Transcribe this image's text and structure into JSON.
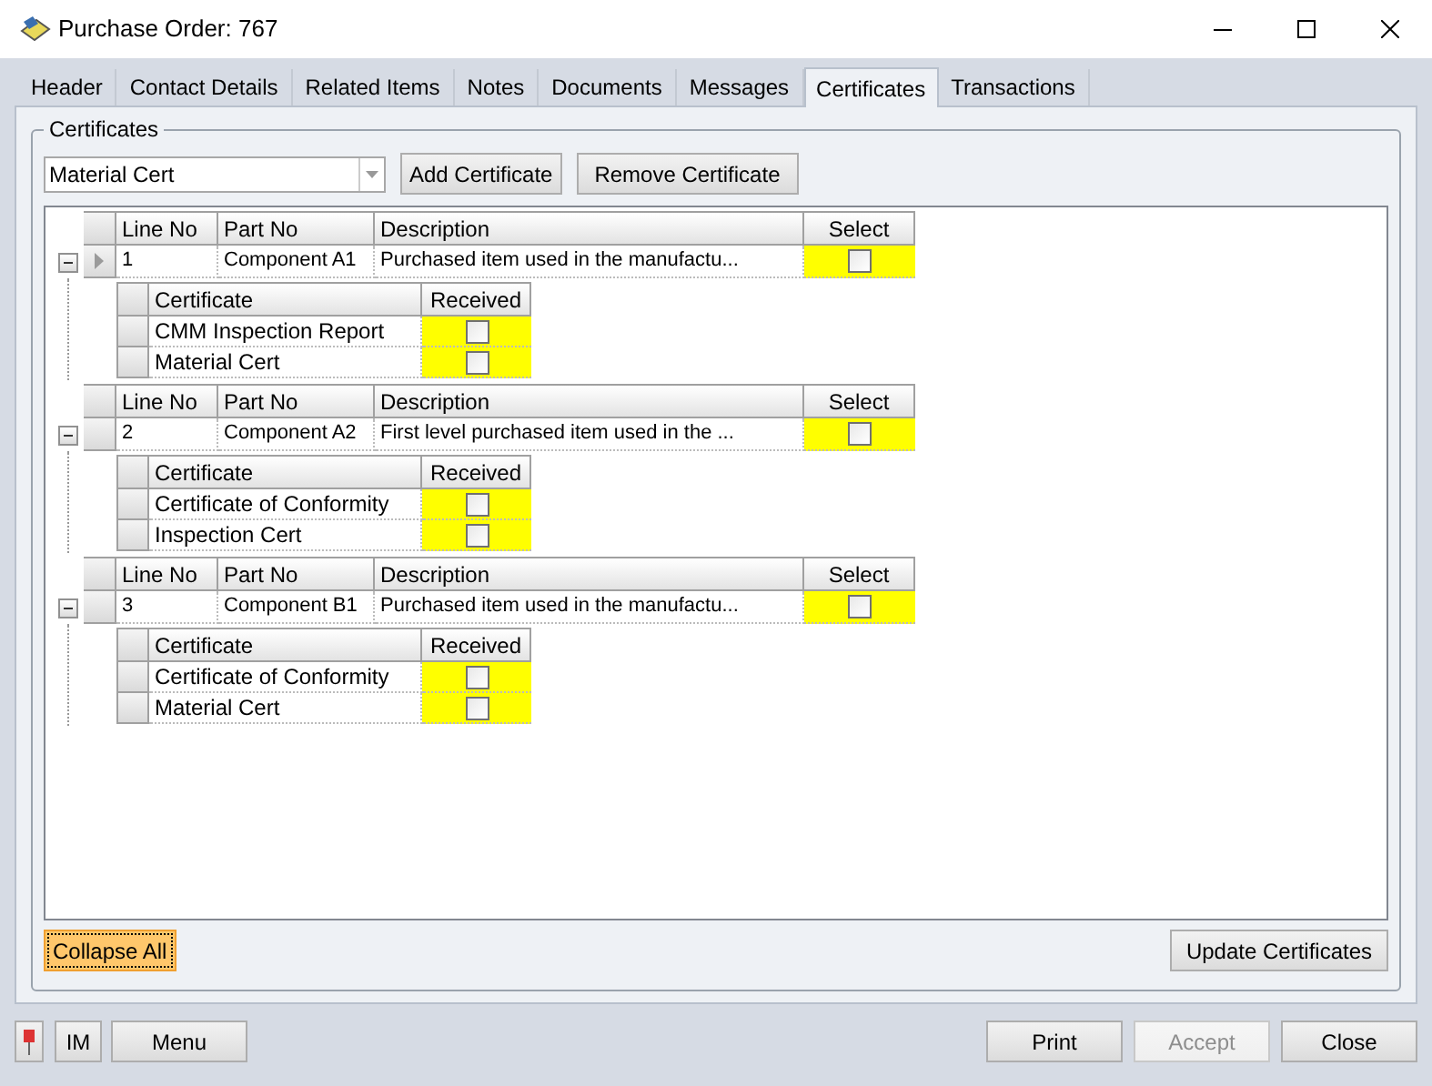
{
  "window": {
    "title": "Purchase Order: 767"
  },
  "tabs": [
    {
      "label": "Header",
      "selected": false
    },
    {
      "label": "Contact Details",
      "selected": false
    },
    {
      "label": "Related Items",
      "selected": false
    },
    {
      "label": "Notes",
      "selected": false
    },
    {
      "label": "Documents",
      "selected": false
    },
    {
      "label": "Messages",
      "selected": false
    },
    {
      "label": "Certificates",
      "selected": true
    },
    {
      "label": "Transactions",
      "selected": false
    }
  ],
  "group": {
    "title": "Certificates",
    "combo_value": "Material Cert",
    "add_button": "Add Certificate",
    "remove_button": "Remove Certificate"
  },
  "lines": [
    {
      "columns": [
        "Line No",
        "Part No",
        "Description",
        "Select"
      ],
      "line_no": "1",
      "part_no": "Component A1",
      "description": "Purchased item used in the manufactu...",
      "checked": false,
      "current": true,
      "expanded": true,
      "cert_columns": [
        "Certificate",
        "Received"
      ],
      "certificates": [
        {
          "name": "CMM Inspection Report",
          "received": false
        },
        {
          "name": "Material Cert",
          "received": false
        }
      ]
    },
    {
      "columns": [
        "Line No",
        "Part No",
        "Description",
        "Select"
      ],
      "line_no": "2",
      "part_no": "Component A2",
      "description": "First level purchased item used in the ...",
      "checked": false,
      "current": false,
      "expanded": true,
      "cert_columns": [
        "Certificate",
        "Received"
      ],
      "certificates": [
        {
          "name": "Certificate of Conformity",
          "received": false
        },
        {
          "name": "Inspection Cert",
          "received": false
        }
      ]
    },
    {
      "columns": [
        "Line No",
        "Part No",
        "Description",
        "Select"
      ],
      "line_no": "3",
      "part_no": "Component B1",
      "description": "Purchased item used in the manufactu...",
      "checked": false,
      "current": false,
      "expanded": true,
      "cert_columns": [
        "Certificate",
        "Received"
      ],
      "certificates": [
        {
          "name": "Certificate of Conformity",
          "received": false
        },
        {
          "name": "Material Cert",
          "received": false
        }
      ]
    }
  ],
  "collapse_all": {
    "label": "Collapse All",
    "focused": true
  },
  "update_button": "Update Certificates",
  "footer": {
    "im": "IM",
    "menu": "Menu",
    "buttons": [
      {
        "label": "Print",
        "disabled": false
      },
      {
        "label": "Accept",
        "disabled": true
      },
      {
        "label": "Close",
        "disabled": false
      }
    ]
  }
}
